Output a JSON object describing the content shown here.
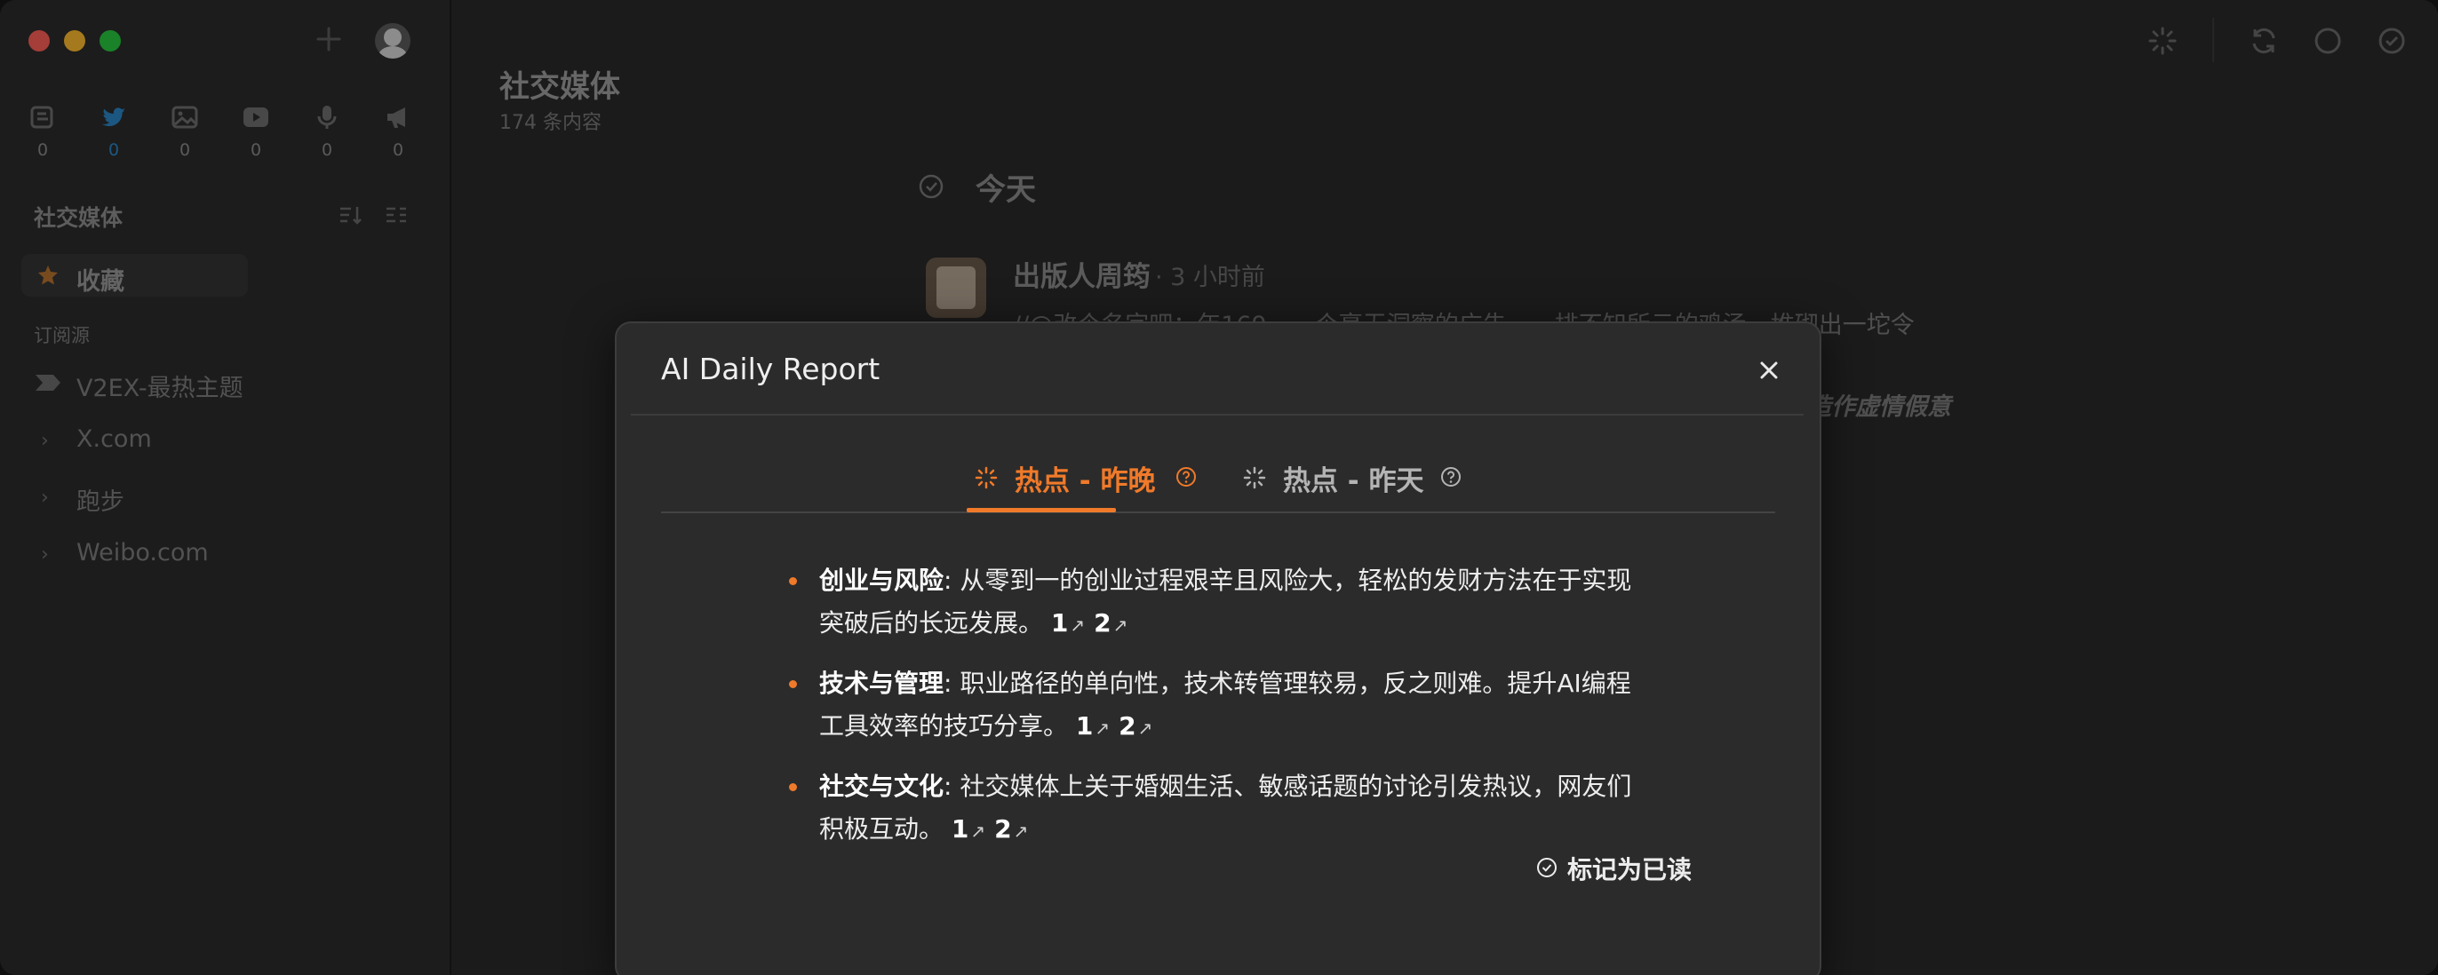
{
  "sidebar": {
    "types": [
      {
        "icon": "article-icon",
        "count": "0"
      },
      {
        "icon": "twitter-icon",
        "count": "0"
      },
      {
        "icon": "image-icon",
        "count": "0"
      },
      {
        "icon": "video-icon",
        "count": "0"
      },
      {
        "icon": "microphone-icon",
        "count": "0"
      },
      {
        "icon": "megaphone-icon",
        "count": "0"
      }
    ],
    "section_title": "社交媒体",
    "favorites_label": "收藏",
    "subscriptions_label": "订阅源",
    "feeds": [
      {
        "label": "V2EX-最热主题"
      },
      {
        "label": "X.com"
      },
      {
        "label": "跑步"
      },
      {
        "label": "Weibo.com"
      }
    ]
  },
  "main": {
    "title": "社交媒体",
    "count": "174 条内容",
    "today_label": "今天",
    "post": {
      "author": "出版人周筠",
      "time": "· 3 小时前",
      "text": "//@改个名字吧：年169…一个毫无洞察的广告……排不知所云的鸡汤…堆砌出一坨令",
      "tail": "造作虚情假意"
    }
  },
  "modal": {
    "title": "AI Daily Report",
    "tabs": [
      {
        "label": "热点 - 昨晚",
        "active": true
      },
      {
        "label": "热点 - 昨天",
        "active": false
      }
    ],
    "bullets": [
      {
        "title": "创业与风险",
        "text": ": 从零到一的创业过程艰辛且风险大，轻松的发财方法在于实现突破后的长远发展。",
        "refs": [
          "1",
          "2"
        ]
      },
      {
        "title": "技术与管理",
        "text": ": 职业路径的单向性，技术转管理较易，反之则难。提升AI编程工具效率的技巧分享。",
        "refs": [
          "1",
          "2"
        ]
      },
      {
        "title": "社交与文化",
        "text": ": 社交媒体上关于婚姻生活、敏感话题的讨论引发热议，网友们积极互动。",
        "refs": [
          "1",
          "2"
        ]
      }
    ],
    "mark_read_label": "标记为已读"
  },
  "colors": {
    "accent": "#f07a2a",
    "twitter_blue": "#2c86c7",
    "close_red": "#fe5f57",
    "minimize_yellow": "#febc2e",
    "zoom_green": "#28c840"
  }
}
